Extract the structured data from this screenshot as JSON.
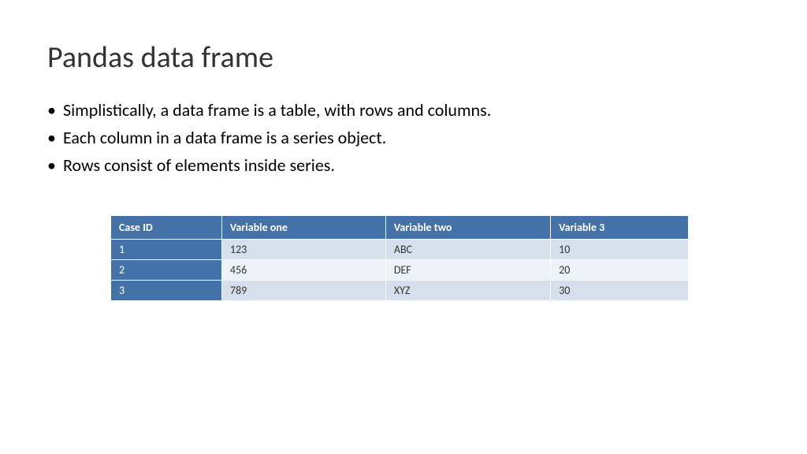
{
  "title": "Pandas data frame",
  "bullets": [
    "Simplistically, a data frame is a table, with rows and columns.",
    "Each column in a data frame is a series object.",
    "Rows consist of elements inside series."
  ],
  "table": {
    "headers": [
      "Case ID",
      "Variable one",
      "Variable two",
      "Variable 3"
    ],
    "rows": [
      [
        "1",
        "123",
        "ABC",
        "10"
      ],
      [
        "2",
        "456",
        "DEF",
        "20"
      ],
      [
        "3",
        "789",
        "XYZ",
        "30"
      ]
    ]
  }
}
